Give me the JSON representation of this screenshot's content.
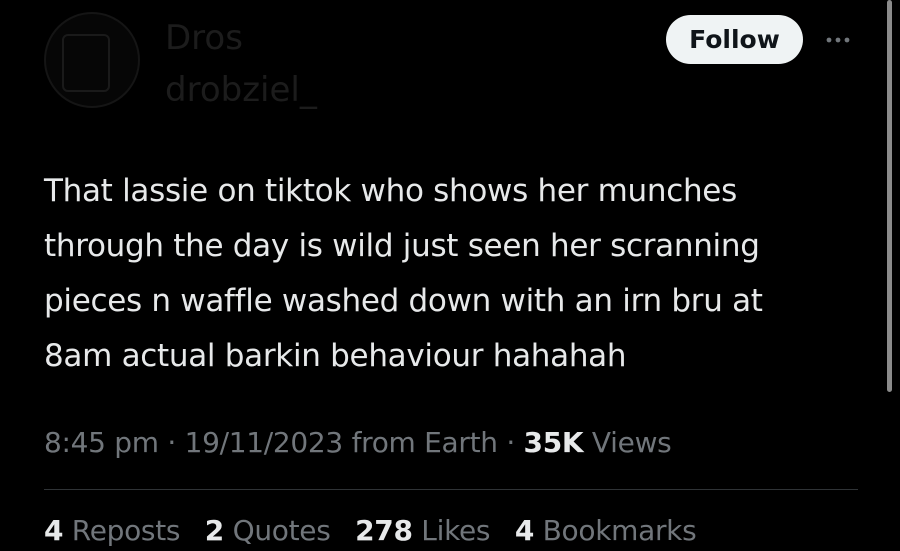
{
  "header": {
    "display_name": "Dros",
    "handle": "drobziel_",
    "follow_label": "Follow",
    "more_icon": "more-horizontal-icon"
  },
  "tweet": {
    "text": "That lassie on tiktok who shows her munches\nthrough the day is wild just seen her scranning\npieces n waffle washed down with an irn bru at\n8am actual barkin behaviour hahahah",
    "time": "8:45 pm",
    "date": "19/11/2023",
    "source": "from Earth",
    "separator": "·",
    "views_count": "35K",
    "views_label": "Views"
  },
  "stats": [
    {
      "count": "4",
      "label": "Reposts"
    },
    {
      "count": "2",
      "label": "Quotes"
    },
    {
      "count": "278",
      "label": "Likes"
    },
    {
      "count": "4",
      "label": "Bookmarks"
    }
  ],
  "colors": {
    "background": "#000000",
    "primary_text": "#e7e9ea",
    "secondary_text": "#71767b",
    "follow_button_bg": "#eff3f4",
    "follow_button_text": "#0f1419",
    "divider": "#2f3336"
  }
}
